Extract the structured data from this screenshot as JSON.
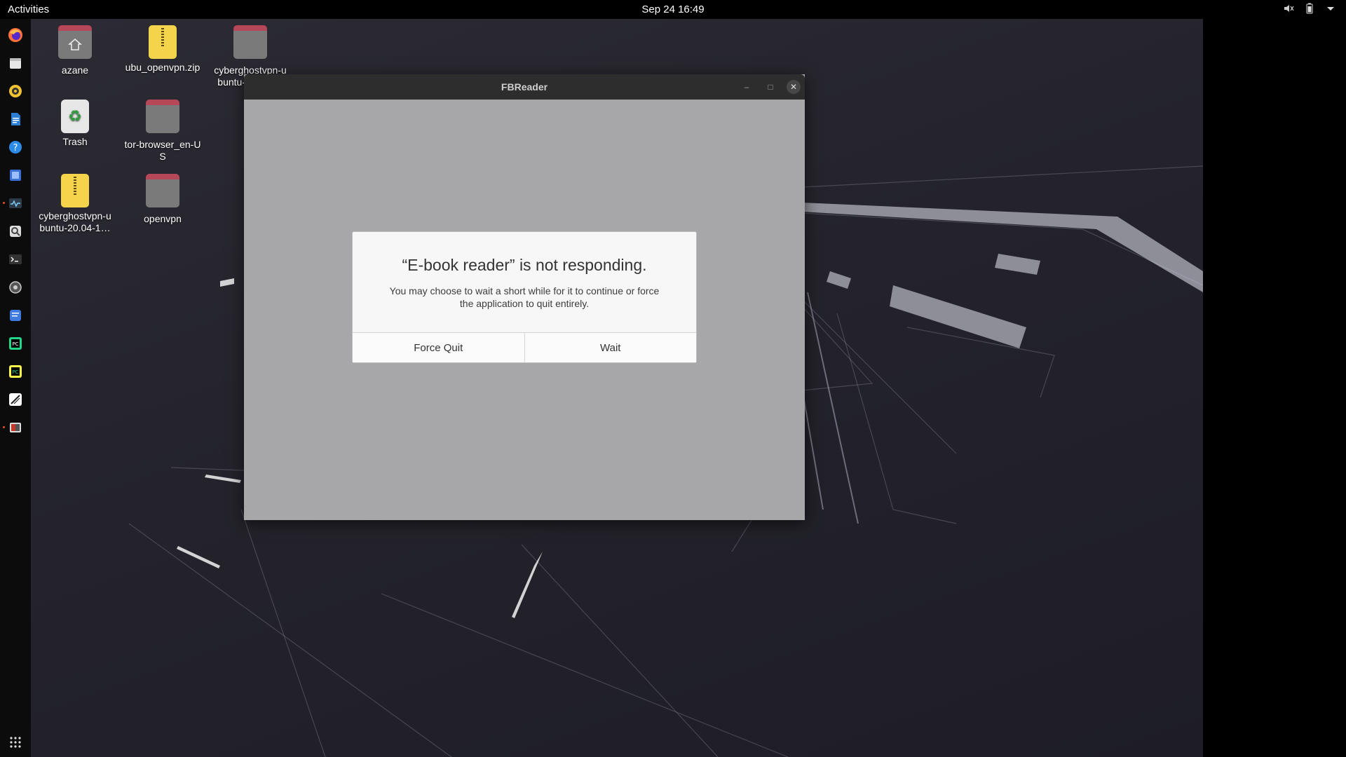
{
  "topbar": {
    "activities": "Activities",
    "clock": "Sep 24  16:49",
    "icons": [
      "speaker-icon",
      "battery-icon",
      "system-menu-arrow-icon"
    ]
  },
  "dock": {
    "apps": [
      "firefox-icon",
      "files-icon",
      "rhythmbox-icon",
      "writer-icon",
      "help-icon",
      "screenshot-icon",
      "system-monitor-icon",
      "image-viewer-icon",
      "terminal-icon",
      "settings-icon",
      "text-editor-icon",
      "pycharm-icon",
      "pycharm-ce-icon",
      "drawing-icon",
      "image-app-icon"
    ],
    "show_apps": "show-applications-icon"
  },
  "desktop": {
    "icons": [
      {
        "label": "azane",
        "type": "home-folder"
      },
      {
        "label": "ubu_openvpn.zip",
        "type": "zip"
      },
      {
        "label": "cyberghostvpn-ubuntu-20.04-…",
        "type": "folder"
      },
      {
        "label": "Trash",
        "type": "trash"
      },
      {
        "label": "tor-browser_en-US",
        "type": "folder"
      },
      {
        "label": "cyberghostvpn-ubuntu-20.04-1…",
        "type": "zip"
      },
      {
        "label": "openvpn",
        "type": "folder"
      }
    ]
  },
  "window": {
    "title": "FBReader",
    "minimize": "–",
    "maximize": "□",
    "close": "✕"
  },
  "dialog": {
    "heading": "“E-book reader” is not responding.",
    "body": "You may choose to wait a short while for it to continue or force the application to quit entirely.",
    "force_quit": "Force Quit",
    "wait": "Wait"
  },
  "colors": {
    "accent": "#e95420",
    "folder_tab": "#b54758",
    "zip": "#f5d44b"
  }
}
